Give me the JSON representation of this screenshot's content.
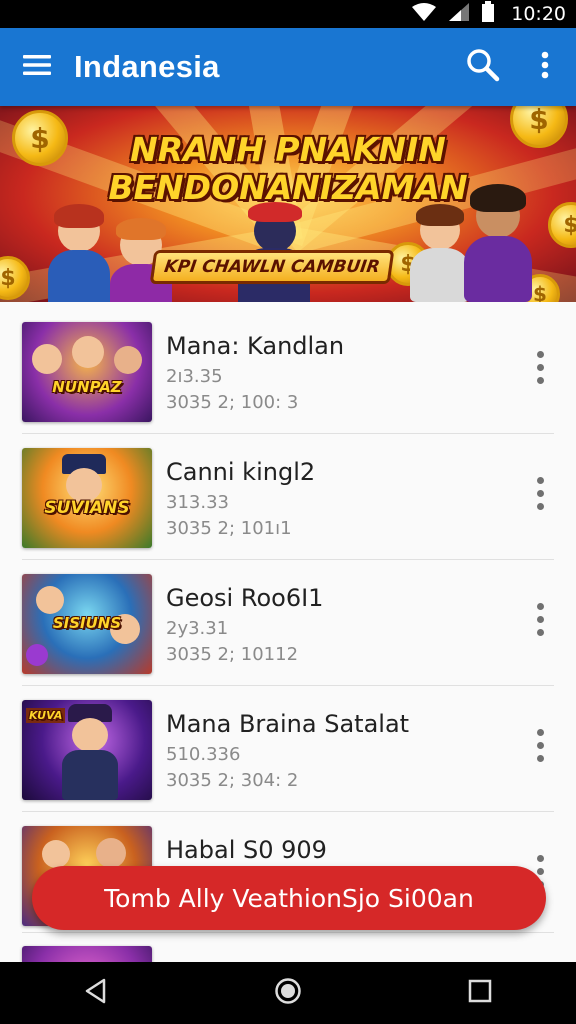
{
  "status_bar": {
    "time": "10:20"
  },
  "app_bar": {
    "title": "Indanesia",
    "icons": [
      "menu-icon",
      "search-icon",
      "more-vert-icon"
    ]
  },
  "banner": {
    "title_line1": "NRANH PNAKNIN",
    "title_line2": "BENDONANIZAMAN",
    "subtitle": "KPI CHAWLN CAMBUIR"
  },
  "list": {
    "items": [
      {
        "title": "Mana: Kandlan",
        "line1": "2ı3.35",
        "line2": "3035 2; 100: 3",
        "thumb_label": "NUNPAZ"
      },
      {
        "title": "Canni kingl2",
        "line1": "313.33",
        "line2": "3035 2; 101ı1",
        "thumb_label": "SUVIANS"
      },
      {
        "title": "Geosi Roo6I1",
        "line1": "2y3.31",
        "line2": "3035 2; 10112",
        "thumb_label": "SISIUNS"
      },
      {
        "title": "Mana Braina Satalat",
        "line1": "510.336",
        "line2": "3035 2; 304: 2",
        "thumb_label": "KUVA"
      },
      {
        "title": "Habal S0 909",
        "line1": "",
        "line2": "",
        "thumb_label": ""
      },
      {
        "title": "",
        "line1": "",
        "line2": "",
        "thumb_label": ""
      }
    ]
  },
  "cta": {
    "label": "Tomb Ally VeathionSjo Si00an"
  },
  "nav_bar": {
    "icons": [
      "back-icon",
      "home-icon",
      "recents-icon"
    ]
  },
  "colors": {
    "app_bar": "#1976d2",
    "cta": "#d62828",
    "status_bar": "#000000"
  }
}
